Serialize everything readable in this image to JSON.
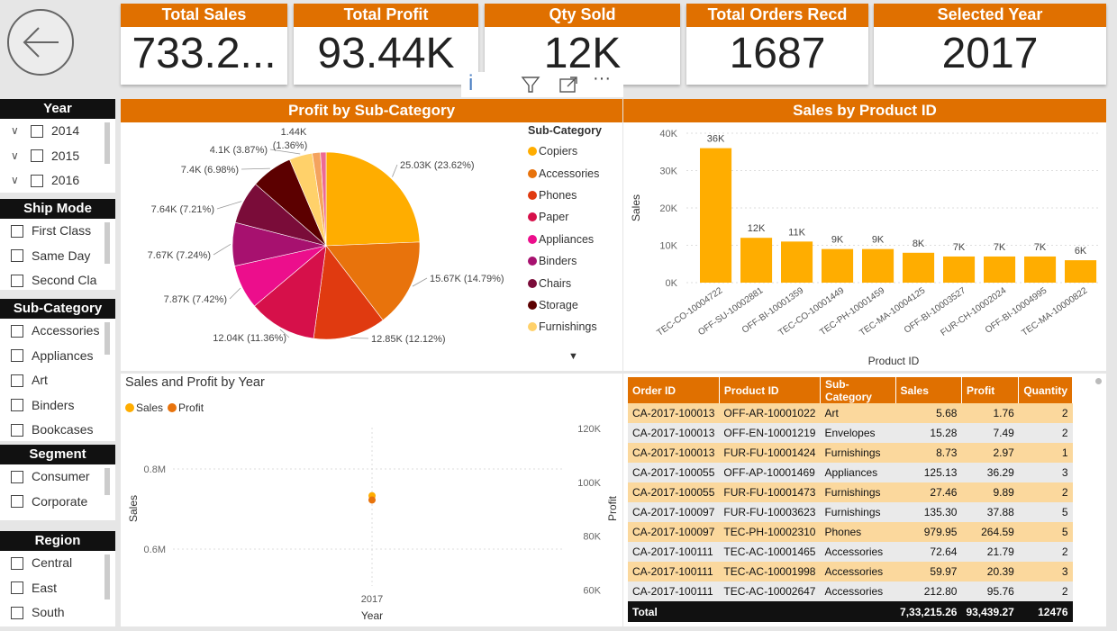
{
  "kpis": [
    {
      "label": "Total Sales",
      "value": "733.2..."
    },
    {
      "label": "Total Profit",
      "value": "93.44K"
    },
    {
      "label": "Qty Sold",
      "value": "12K"
    },
    {
      "label": "Total Orders Recd",
      "value": "1687"
    },
    {
      "label": "Selected Year",
      "value": "2017"
    }
  ],
  "slicers": {
    "year": {
      "title": "Year",
      "items": [
        "2014",
        "2015",
        "2016"
      ]
    },
    "ship_mode": {
      "title": "Ship Mode",
      "items": [
        "First Class",
        "Same Day",
        "Second Cla"
      ]
    },
    "sub_category": {
      "title": "Sub-Category",
      "items": [
        "Accessories",
        "Appliances",
        "Art",
        "Binders",
        "Bookcases"
      ]
    },
    "segment": {
      "title": "Segment",
      "items": [
        "Consumer",
        "Corporate"
      ]
    },
    "region": {
      "title": "Region",
      "items": [
        "Central",
        "East",
        "South"
      ]
    }
  },
  "pie_panel": {
    "title": "Profit by Sub-Category",
    "legend_title": "Sub-Category",
    "legend": [
      "Copiers",
      "Accessories",
      "Phones",
      "Paper",
      "Appliances",
      "Binders",
      "Chairs",
      "Storage",
      "Furnishings"
    ]
  },
  "bar_panel": {
    "title": "Sales by Product ID"
  },
  "line_panel": {
    "title": "Sales and Profit by Year",
    "legend": [
      "Sales",
      "Profit"
    ]
  },
  "chart_data": [
    {
      "type": "pie",
      "title": "Profit by Sub-Category",
      "labels": [
        "Copiers",
        "Accessories",
        "Phones",
        "Paper",
        "Appliances",
        "Binders",
        "Chairs",
        "Storage",
        "Furnishings",
        "",
        ""
      ],
      "values": [
        25.03,
        15.67,
        12.85,
        12.04,
        7.87,
        7.67,
        7.64,
        7.4,
        4.1,
        1.44,
        1.0
      ],
      "data_labels": [
        "25.03K (23.62%)",
        "15.67K (14.79%)",
        "12.85K (12.12%)",
        "12.04K (11.36%)",
        "7.87K (7.42%)",
        "7.67K (7.24%)",
        "7.64K (7.21%)",
        "7.4K (6.98%)",
        "4.1K (3.87%)",
        "1.44K",
        "(1.36%)"
      ],
      "colors": [
        "#ffad00",
        "#e8730c",
        "#e03a10",
        "#d6104a",
        "#ec0e8c",
        "#a7116f",
        "#7a0c39",
        "#5c0000",
        "#ffd16a",
        "#f4a35e",
        "#ee6b93"
      ]
    },
    {
      "type": "bar",
      "title": "Sales by Product ID",
      "xlabel": "Product ID",
      "ylabel": "Sales",
      "categories": [
        "TEC-CO-10004722",
        "OFF-SU-10002881",
        "OFF-BI-10001359",
        "TEC-CO-10001449",
        "TEC-PH-10001459",
        "TEC-MA-10004125",
        "OFF-BI-10003527",
        "FUR-CH-10002024",
        "OFF-BI-10004995",
        "TEC-MA-10000822"
      ],
      "values": [
        36,
        12,
        11,
        9,
        9,
        8,
        7,
        7,
        7,
        6
      ],
      "data_labels": [
        "36K",
        "12K",
        "11K",
        "9K",
        "9K",
        "8K",
        "7K",
        "7K",
        "7K",
        "6K"
      ],
      "ylim": [
        0,
        40
      ],
      "yticks": [
        "0K",
        "10K",
        "20K",
        "30K",
        "40K"
      ],
      "color": "#ffad00"
    },
    {
      "type": "line",
      "title": "Sales and Profit by Year",
      "xlabel": "Year",
      "ylabel": "Sales",
      "y2label": "Profit",
      "x": [
        "2017"
      ],
      "series": [
        {
          "name": "Sales",
          "values": [
            0.7332
          ],
          "color": "#ffad00"
        },
        {
          "name": "Profit",
          "values": [
            93.44
          ],
          "color": "#e8730c"
        }
      ],
      "yticks_left": [
        "0.8M",
        "0.6M"
      ],
      "yticks_right": [
        "120K",
        "100K",
        "80K",
        "60K"
      ]
    }
  ],
  "table": {
    "columns": [
      "Order ID",
      "Product ID",
      "Sub-Category",
      "Sales",
      "Profit",
      "Quantity"
    ],
    "rows": [
      [
        "CA-2017-100013",
        "OFF-AR-10001022",
        "Art",
        "5.68",
        "1.76",
        "2"
      ],
      [
        "CA-2017-100013",
        "OFF-EN-10001219",
        "Envelopes",
        "15.28",
        "7.49",
        "2"
      ],
      [
        "CA-2017-100013",
        "FUR-FU-10001424",
        "Furnishings",
        "8.73",
        "2.97",
        "1"
      ],
      [
        "CA-2017-100055",
        "OFF-AP-10001469",
        "Appliances",
        "125.13",
        "36.29",
        "3"
      ],
      [
        "CA-2017-100055",
        "FUR-FU-10001473",
        "Furnishings",
        "27.46",
        "9.89",
        "2"
      ],
      [
        "CA-2017-100097",
        "FUR-FU-10003623",
        "Furnishings",
        "135.30",
        "37.88",
        "5"
      ],
      [
        "CA-2017-100097",
        "TEC-PH-10002310",
        "Phones",
        "979.95",
        "264.59",
        "5"
      ],
      [
        "CA-2017-100111",
        "TEC-AC-10001465",
        "Accessories",
        "72.64",
        "21.79",
        "2"
      ],
      [
        "CA-2017-100111",
        "TEC-AC-10001998",
        "Accessories",
        "59.97",
        "20.39",
        "3"
      ],
      [
        "CA-2017-100111",
        "TEC-AC-10002647",
        "Accessories",
        "212.80",
        "95.76",
        "2"
      ]
    ],
    "total": [
      "Total",
      "",
      "",
      "7,33,215.26",
      "93,439.27",
      "12476"
    ]
  }
}
